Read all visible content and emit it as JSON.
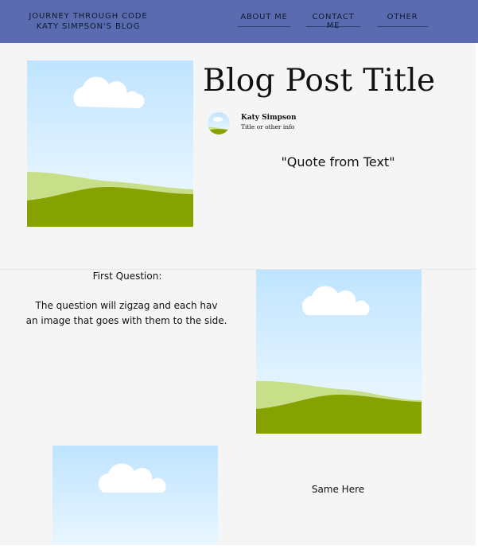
{
  "header": {
    "brand_line1": "JOURNEY THROUGH CODE",
    "brand_line2": "KATY SIMPSON'S BLOG",
    "nav": {
      "about": "ABOUT ME",
      "contact": "CONTACT ME",
      "other": "OTHER"
    },
    "bar_color": "#5a6caf"
  },
  "post": {
    "title": "Blog Post Title",
    "author_name": "Katy Simpson",
    "author_info": "Title or other info",
    "quote": "\"Quote from Text\""
  },
  "sections": [
    {
      "heading": "First Question:",
      "body_line1": "The question will zigzag and each hav",
      "body_line2": "an image that goes with them to the side."
    },
    {
      "body": "Same Here"
    }
  ],
  "images": {
    "hero": "landscape-placeholder-icon",
    "avatar": "landscape-placeholder-icon",
    "section1": "landscape-placeholder-icon",
    "section2": "landscape-placeholder-icon"
  },
  "colors": {
    "sky_top": "#bfe4ff",
    "sky_bottom": "#f1f9ff",
    "hill_light": "#c6df88",
    "hill_dark": "#86a200",
    "cloud": "#ffffff"
  }
}
